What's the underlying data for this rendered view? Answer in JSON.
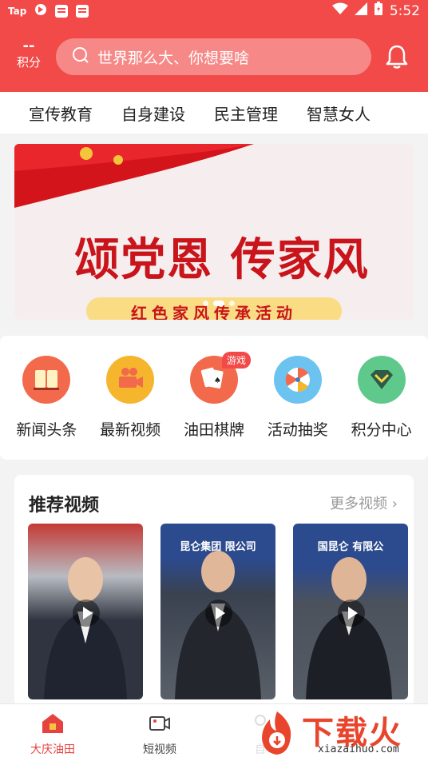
{
  "status_bar": {
    "left_label": "Tap",
    "time": "5:52"
  },
  "header": {
    "points_value": "--",
    "points_label": "积分",
    "search_placeholder": "世界那么大、你想要啥"
  },
  "category_tabs": [
    "宣传教育",
    "自身建设",
    "民主管理",
    "智慧女人"
  ],
  "banner": {
    "headline": "颂党恩 传家风",
    "subtitle": "红色家风传承活动",
    "slide_count": 3,
    "active_slide": 2
  },
  "shortcuts": [
    {
      "label": "新闻头条",
      "icon": "book-icon",
      "color": "#f26a4b"
    },
    {
      "label": "最新视频",
      "icon": "video-camera-icon",
      "color": "#f5b52d"
    },
    {
      "label": "油田棋牌",
      "icon": "playing-cards-icon",
      "color": "#f26a4b",
      "badge": "游戏"
    },
    {
      "label": "活动抽奖",
      "icon": "prize-wheel-icon",
      "color": "#6cc3f0"
    },
    {
      "label": "积分中心",
      "icon": "diamond-icon",
      "color": "#5fc98b"
    }
  ],
  "recommended": {
    "title": "推荐视频",
    "more_label": "更多视频",
    "videos": [
      {
        "sign_text": ""
      },
      {
        "sign_text": "昆仑集团 限公司"
      },
      {
        "sign_text": "国昆仑 有限公"
      }
    ]
  },
  "bottom_nav": [
    {
      "label": "大庆油田",
      "icon": "home-icon",
      "active": true
    },
    {
      "label": "短视频",
      "icon": "video-icon",
      "active": false
    },
    {
      "label": "自",
      "icon": "user-icon",
      "active": false
    }
  ],
  "watermark": {
    "text_cn": "下载火",
    "text_en": "xiazaihuo.com"
  }
}
